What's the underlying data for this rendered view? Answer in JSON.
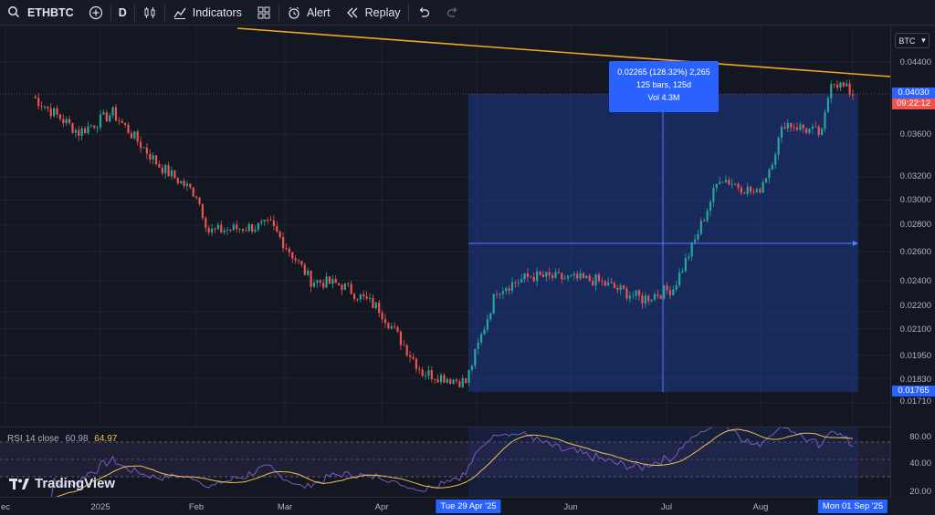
{
  "toolbar": {
    "symbol": "ETHBTC",
    "interval": "D",
    "indicators_label": "Indicators",
    "alert_label": "Alert",
    "replay_label": "Replay"
  },
  "price_axis": {
    "currency": "BTC",
    "ticks": [
      "0.04400",
      "0.03600",
      "0.03200",
      "0.03000",
      "0.02800",
      "0.02600",
      "0.02400",
      "0.02200",
      "0.02100",
      "0.01950",
      "0.01830",
      "0.01710"
    ],
    "current_price": "0.04030",
    "countdown": "09:22:12",
    "range_low_label": "0.01765"
  },
  "rsi_axis": {
    "ticks": [
      "80.00",
      "40.00",
      "20.00"
    ]
  },
  "measure_box": {
    "line1": "0.02265 (128.32%) 2,265",
    "line2": "125 bars, 125d",
    "line3": "Vol 4.3M"
  },
  "rsi": {
    "label": "RSI 14 close",
    "value1": "60.98",
    "value2": "64.97"
  },
  "time_axis": {
    "labels": [
      "ec",
      "2025",
      "Feb",
      "Mar",
      "Apr",
      "Tue 29 Apr '25",
      "Jun",
      "Jul",
      "Aug",
      "Mon 01 Sep '25"
    ]
  },
  "branding": {
    "name": "TradingView"
  },
  "colors": {
    "up": "#26a69a",
    "down": "#ef5350",
    "accent": "#2962ff",
    "trendline": "#f5a623",
    "rsi": "#7e57c2",
    "rsi_ma": "#f0c14b"
  },
  "chart_data": {
    "type": "candlestick",
    "symbol": "ETHBTC",
    "interval": "1D",
    "y_scale": "log",
    "ylim": [
      0.0171,
      0.0455
    ],
    "x_range": [
      "Dec 2024",
      "Sep 2025"
    ],
    "close_anchors": [
      {
        "date": "2024-12-10",
        "close": 0.04
      },
      {
        "date": "2024-12-25",
        "close": 0.0362
      },
      {
        "date": "2025-01-05",
        "close": 0.0382
      },
      {
        "date": "2025-01-20",
        "close": 0.033
      },
      {
        "date": "2025-02-01",
        "close": 0.0305
      },
      {
        "date": "2025-02-05",
        "close": 0.0275
      },
      {
        "date": "2025-02-25",
        "close": 0.028
      },
      {
        "date": "2025-03-10",
        "close": 0.024
      },
      {
        "date": "2025-03-20",
        "close": 0.0237
      },
      {
        "date": "2025-04-01",
        "close": 0.0222
      },
      {
        "date": "2025-04-15",
        "close": 0.0186
      },
      {
        "date": "2025-04-29",
        "close": 0.0181
      },
      {
        "date": "2025-05-09",
        "close": 0.0234
      },
      {
        "date": "2025-05-20",
        "close": 0.0243
      },
      {
        "date": "2025-06-10",
        "close": 0.024
      },
      {
        "date": "2025-06-25",
        "close": 0.0228
      },
      {
        "date": "2025-07-05",
        "close": 0.0235
      },
      {
        "date": "2025-07-12",
        "close": 0.0268
      },
      {
        "date": "2025-07-20",
        "close": 0.032
      },
      {
        "date": "2025-08-01",
        "close": 0.0305
      },
      {
        "date": "2025-08-05",
        "close": 0.0328
      },
      {
        "date": "2025-08-10",
        "close": 0.0372
      },
      {
        "date": "2025-08-22",
        "close": 0.036
      },
      {
        "date": "2025-08-25",
        "close": 0.042
      },
      {
        "date": "2025-09-01",
        "close": 0.0403
      }
    ],
    "measure": {
      "from_date": "2025-04-29",
      "to_date": "2025-09-01",
      "from_price": 0.01765,
      "to_price": 0.0403,
      "change_pct": 128.32,
      "bars": 125
    },
    "rsi": {
      "length": 14,
      "value": 60.98,
      "ma": 64.97,
      "bands": [
        70,
        30
      ]
    }
  }
}
